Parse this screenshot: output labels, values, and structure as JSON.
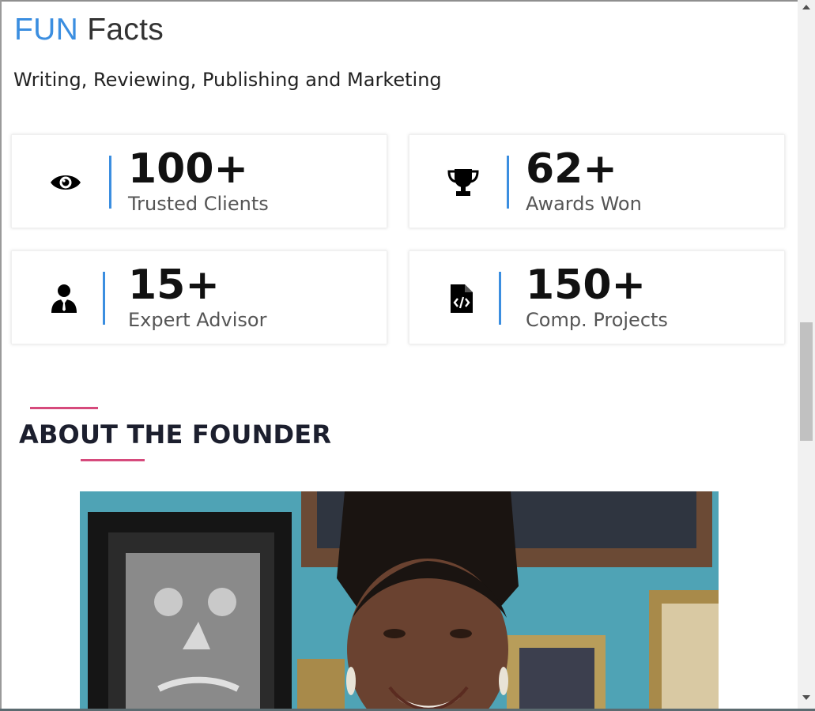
{
  "fun_facts": {
    "title_accent": "FUN",
    "title_rest": " Facts",
    "subtitle": "Writing, Reviewing, Publishing and Marketing"
  },
  "stats": [
    {
      "value": "100+",
      "label": "Trusted Clients",
      "icon": "eye-icon"
    },
    {
      "value": "62+",
      "label": "Awards Won",
      "icon": "trophy-icon"
    },
    {
      "value": "15+",
      "label": "Expert Advisor",
      "icon": "advisor-icon"
    },
    {
      "value": "150+",
      "label": "Comp. Projects",
      "icon": "code-file-icon"
    }
  ],
  "founder": {
    "title": "ABOUT THE FOUNDER"
  },
  "colors": {
    "accent_blue": "#3b8ee0",
    "accent_pink": "#d64a7c",
    "heading_dark": "#1c1f2e"
  }
}
